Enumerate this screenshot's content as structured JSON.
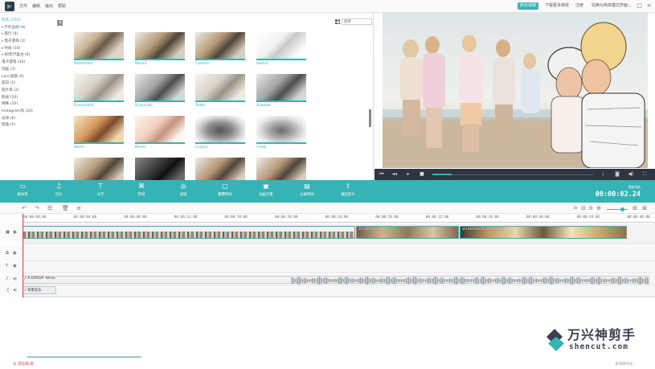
{
  "menu": [
    "文件",
    "编辑",
    "输出",
    "帮助"
  ],
  "titlebar_buttons": {
    "buy": "购买视频",
    "download_effects": "下载更多特效",
    "account": "注册",
    "switch_mode": "切换为简单模式界面"
  },
  "library": {
    "collapse_symbol": "◂",
    "search_placeholder": "搜索",
    "categories": [
      {
        "label": "所有 (152)",
        "active": true,
        "arrow": false
      },
      {
        "label": "户外运动 (4)",
        "active": false,
        "arrow": true
      },
      {
        "label": "旅行 (4)",
        "active": false,
        "arrow": true
      },
      {
        "label": "电子游戏 (2)",
        "active": false,
        "arrow": true
      },
      {
        "label": "时尚 (10)",
        "active": false,
        "arrow": true
      },
      {
        "label": "80年代复古 (6)",
        "active": false,
        "arrow": true
      },
      {
        "label": "电子游戏 (10)",
        "active": false,
        "arrow": false
      },
      {
        "label": "动画 (3)",
        "active": false,
        "arrow": false
      },
      {
        "label": "Lens滤镜 (4)",
        "active": false,
        "arrow": false
      },
      {
        "label": "黑白 (2)",
        "active": false,
        "arrow": false
      },
      {
        "label": "胶片风 (2)",
        "active": false,
        "arrow": false
      },
      {
        "label": "影视 (10)",
        "active": false,
        "arrow": false
      },
      {
        "label": "特殊 (10)",
        "active": false,
        "arrow": false
      },
      {
        "label": "Instagram风 (24)",
        "active": false,
        "arrow": false
      },
      {
        "label": "光效 (6)",
        "active": false,
        "arrow": false
      },
      {
        "label": "暗角 (5)",
        "active": false,
        "arrow": false
      }
    ],
    "filters": [
      {
        "name": "Watercolor",
        "style": "watercolor"
      },
      {
        "name": "Mosaic",
        "style": "normal"
      },
      {
        "name": "Cartoon",
        "style": "normal"
      },
      {
        "name": "Sketch",
        "style": "sketch"
      },
      {
        "name": "Crosshatch",
        "style": "pale"
      },
      {
        "name": "Grayscale",
        "style": "gray"
      },
      {
        "name": "Tooth",
        "style": "pale"
      },
      {
        "name": "Shadow",
        "style": "gray"
      },
      {
        "name": "Warm",
        "style": "warm"
      },
      {
        "name": "Bloom",
        "style": "bright"
      },
      {
        "name": "Crayon",
        "style": "crayon"
      },
      {
        "name": "Chalk",
        "style": "chalk"
      },
      {
        "name": "",
        "style": "normal"
      },
      {
        "name": "",
        "style": "dark"
      },
      {
        "name": "",
        "style": "normal"
      },
      {
        "name": "",
        "style": "normal"
      }
    ]
  },
  "toolbar": {
    "tools": [
      {
        "label": "媒体库",
        "icon": "▭"
      },
      {
        "label": "音乐",
        "icon": "♫"
      },
      {
        "label": "文字",
        "icon": "T"
      },
      {
        "label": "转场",
        "icon": "⌘"
      },
      {
        "label": "滤镜",
        "icon": "◎"
      },
      {
        "label": "叠覆特效",
        "icon": "▢"
      },
      {
        "label": "动画元素",
        "icon": "▣"
      },
      {
        "label": "分屏特效",
        "icon": "▤"
      },
      {
        "label": "输出影片",
        "icon": "⇪"
      }
    ],
    "timecode_label": "播放进度",
    "timecode": "00:00:02.24"
  },
  "timeline": {
    "ticks": [
      "00:00:00:00",
      "00:00:04:00",
      "00:00:08:00",
      "00:00:12:00",
      "00:00:16:00",
      "00:00:20:00",
      "00:00:24:00",
      "00:00:28:00",
      "00:00:32:00",
      "00:00:36:00",
      "00:00:40:00",
      "00:00:44:00",
      "00:00:48:00"
    ],
    "clips": [
      {
        "name": ""
      },
      {
        "name": "shutterstock_..."
      },
      {
        "name": "shutterstock_v4653418"
      }
    ],
    "audio_track": "♪ A-GROUP -Verse",
    "music_track": "♪ 背景音乐"
  },
  "footer": {
    "add_track": "添加轨道",
    "right_text": "本项目时长"
  },
  "watermark": {
    "cn": "万兴神剪手",
    "en": "shencut.com"
  },
  "colors": {
    "accent": "#35b3b5",
    "clip_border": "#44aaaa",
    "playhead": "#e04a4a"
  }
}
